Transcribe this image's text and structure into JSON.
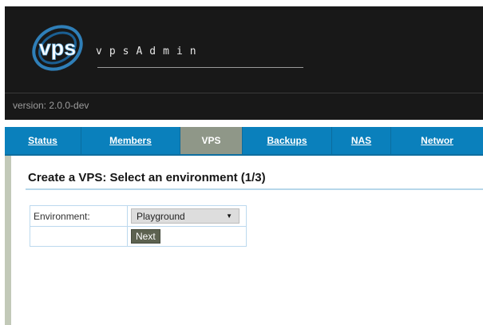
{
  "header": {
    "brand": "vpsAdmin",
    "version": "version: 2.0.0-dev"
  },
  "menu": {
    "items": [
      {
        "label": "Status"
      },
      {
        "label": "Members"
      },
      {
        "label": "VPS"
      },
      {
        "label": "Backups"
      },
      {
        "label": "NAS"
      },
      {
        "label": "Networ"
      }
    ],
    "active": "VPS"
  },
  "page": {
    "title": "Create a VPS: Select an environment (1/3)"
  },
  "form": {
    "environment_label": "Environment:",
    "environment_value": "Playground",
    "next_label": "Next"
  },
  "colors": {
    "header_bg": "#181818",
    "menu_bg": "#0a80bc",
    "menu_active": "#8f9788",
    "button_bg": "#5d6250"
  }
}
